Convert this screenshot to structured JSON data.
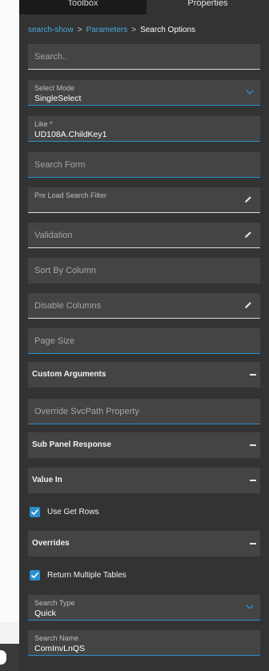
{
  "tabs": {
    "toolbox": "Toolbox",
    "properties": "Properties"
  },
  "breadcrumb": {
    "item1": "search-show",
    "item2": "Parameters",
    "current": "Search Options",
    "separator": ">"
  },
  "search": {
    "placeholder": "Search.."
  },
  "fields": {
    "select_mode": {
      "label": "Select Mode",
      "value": "SingleSelect"
    },
    "like": {
      "label": "Like *",
      "value": "UD108A.ChildKey1"
    },
    "search_form": {
      "placeholder": "Search Form"
    },
    "pre_load_search_filter": {
      "label": "Pre Load Search Filter",
      "hint": "· ·"
    },
    "validation": {
      "placeholder": "Validation"
    },
    "sort_by_column": {
      "placeholder": "Sort By Column"
    },
    "disable_columns": {
      "placeholder": "Disable Columns"
    },
    "page_size": {
      "placeholder": "Page Size"
    },
    "override_svcpath": {
      "placeholder": "Override SvcPath Property"
    },
    "search_type": {
      "label": "Search Type",
      "value": "Quick"
    },
    "search_name": {
      "label": "Search Name",
      "value": "ComInvLnQS"
    }
  },
  "sections": {
    "custom_arguments": "Custom Arguments",
    "sub_panel_response": "Sub Panel Response",
    "value_in": "Value In",
    "overrides": "Overrides"
  },
  "checkboxes": {
    "use_get_rows": {
      "label": "Use Get Rows",
      "checked": true
    },
    "return_multiple_tables": {
      "label": "Return Multiple Tables",
      "checked": true
    }
  },
  "icons": {
    "edit": "pencil-icon",
    "dropdown": "chevron-down-icon",
    "collapse": "minus-icon",
    "check": "checkmark-icon"
  },
  "colors": {
    "accent": "#2a8fcf",
    "panel_bg": "#333333",
    "field_bg": "#444444",
    "link": "#4aa8d8"
  }
}
